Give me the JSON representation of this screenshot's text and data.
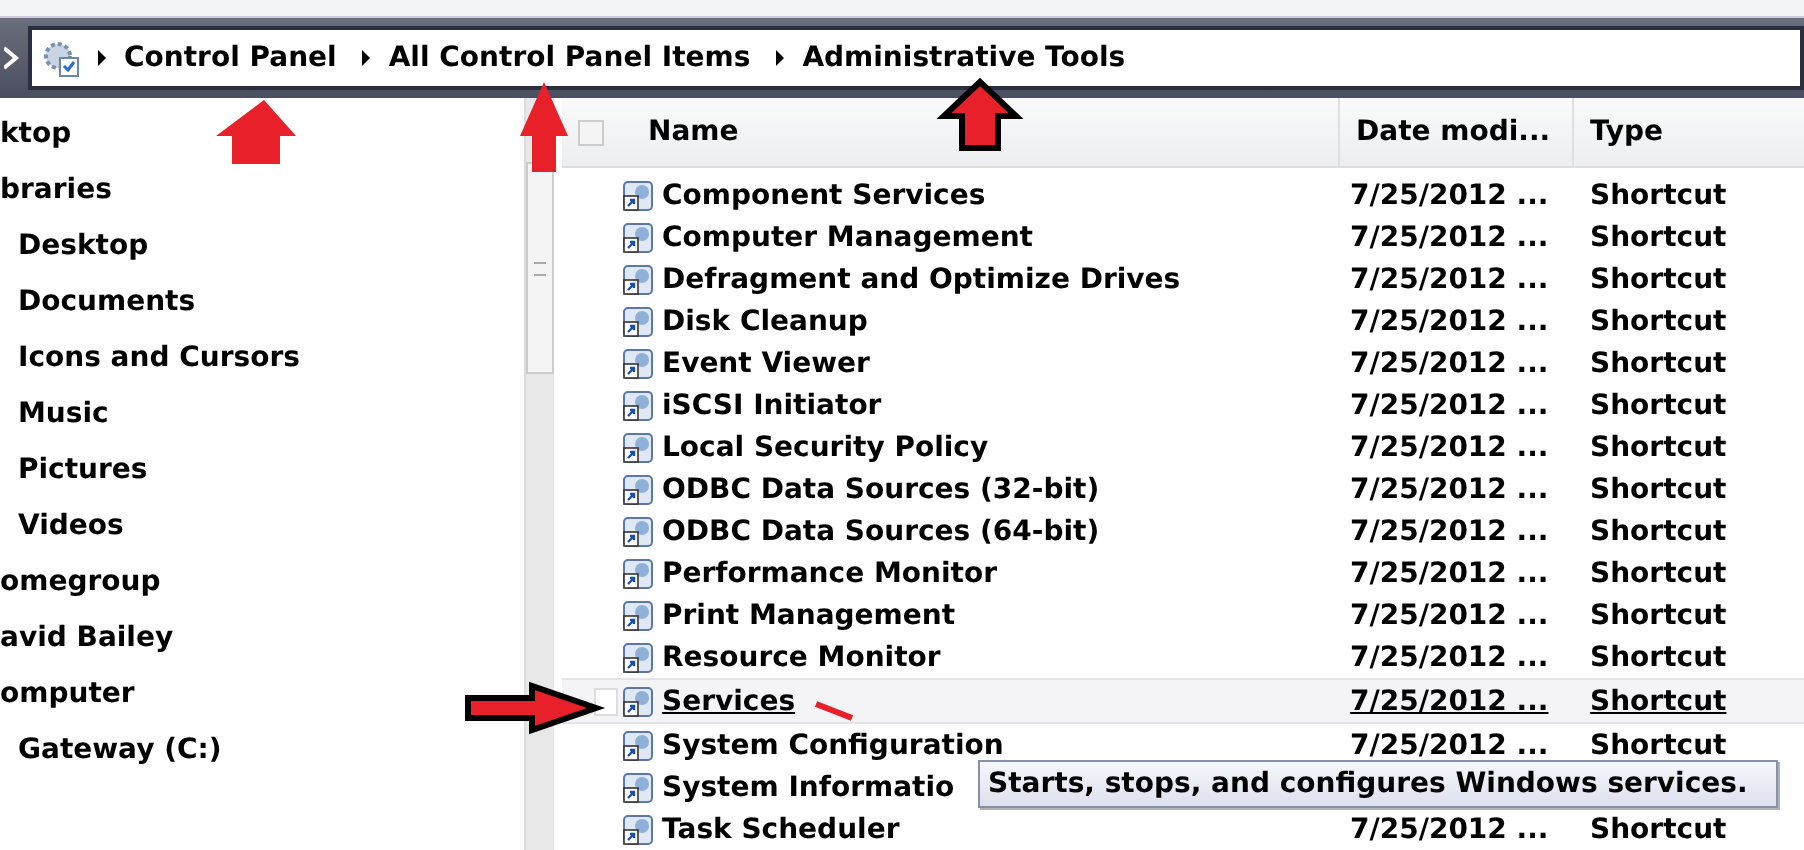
{
  "breadcrumb": [
    {
      "label": "Control Panel"
    },
    {
      "label": "All Control Panel Items"
    },
    {
      "label": "Administrative Tools"
    }
  ],
  "sidebar": {
    "items": [
      {
        "label": "ktop"
      },
      {
        "label": "braries",
        "children": [
          {
            "label": "Desktop"
          },
          {
            "label": "Documents"
          },
          {
            "label": "Icons and Cursors"
          },
          {
            "label": "Music"
          },
          {
            "label": "Pictures"
          },
          {
            "label": "Videos"
          }
        ]
      },
      {
        "label": "omegroup"
      },
      {
        "label": "avid Bailey"
      },
      {
        "label": "omputer",
        "children": [
          {
            "label": "Gateway (C:)"
          }
        ]
      }
    ]
  },
  "table": {
    "select_all": {
      "checked": false
    },
    "columns": [
      "Name",
      "Date modi...",
      "Type"
    ],
    "rows": [
      {
        "name": "Component Services",
        "date": "7/25/2012 ...",
        "type": "Shortcut",
        "selected": false
      },
      {
        "name": "Computer Management",
        "date": "7/25/2012 ...",
        "type": "Shortcut",
        "selected": false
      },
      {
        "name": "Defragment and Optimize Drives",
        "date": "7/25/2012 ...",
        "type": "Shortcut",
        "selected": false
      },
      {
        "name": "Disk Cleanup",
        "date": "7/25/2012 ...",
        "type": "Shortcut",
        "selected": false
      },
      {
        "name": "Event Viewer",
        "date": "7/25/2012 ...",
        "type": "Shortcut",
        "selected": false
      },
      {
        "name": "iSCSI Initiator",
        "date": "7/25/2012 ...",
        "type": "Shortcut",
        "selected": false
      },
      {
        "name": "Local Security Policy",
        "date": "7/25/2012 ...",
        "type": "Shortcut",
        "selected": false
      },
      {
        "name": "ODBC Data Sources (32-bit)",
        "date": "7/25/2012 ...",
        "type": "Shortcut",
        "selected": false
      },
      {
        "name": "ODBC Data Sources (64-bit)",
        "date": "7/25/2012 ...",
        "type": "Shortcut",
        "selected": false
      },
      {
        "name": "Performance Monitor",
        "date": "7/25/2012 ...",
        "type": "Shortcut",
        "selected": false
      },
      {
        "name": "Print Management",
        "date": "7/25/2012 ...",
        "type": "Shortcut",
        "selected": false
      },
      {
        "name": "Resource Monitor",
        "date": "7/25/2012 ...",
        "type": "Shortcut",
        "selected": false
      },
      {
        "name": "Services",
        "date": "7/25/2012 ...",
        "type": "Shortcut",
        "selected": true
      },
      {
        "name": "System Configuration",
        "date": "7/25/2012 ...",
        "type": "Shortcut",
        "selected": false
      },
      {
        "name": "System Informatio",
        "selected": false
      },
      {
        "name": "Task Scheduler",
        "date": "7/25/2012 ...",
        "type": "Shortcut",
        "selected": false
      }
    ]
  },
  "tooltip": {
    "text": "Starts, stops, and configures Windows services."
  }
}
